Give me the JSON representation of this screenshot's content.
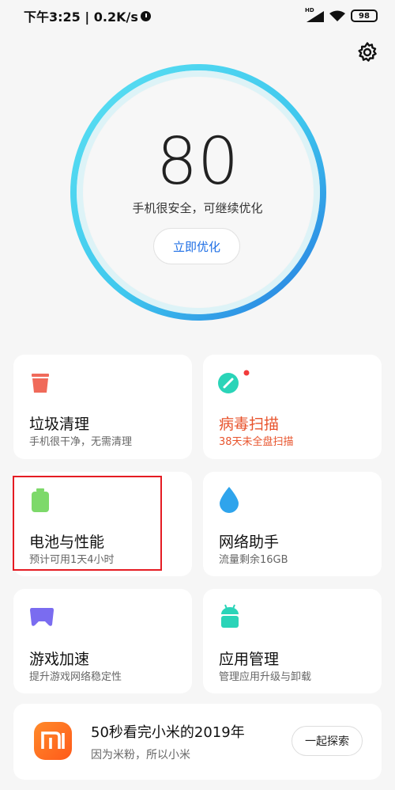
{
  "status_bar": {
    "time_text": "下午3:25 | 0.2K/s",
    "network_label": "HD",
    "battery_level": "98"
  },
  "security": {
    "score": "80",
    "caption": "手机很安全，可继续优化",
    "optimize_label": "立即优化"
  },
  "cards": {
    "cleaner": {
      "title": "垃圾清理",
      "subtitle": "手机很干净，无需清理"
    },
    "virus": {
      "title": "病毒扫描",
      "subtitle": "38天未全盘扫描"
    },
    "battery": {
      "title": "电池与性能",
      "subtitle": "预计可用1天4小时"
    },
    "network": {
      "title": "网络助手",
      "subtitle": "流量剩余16GB"
    },
    "game": {
      "title": "游戏加速",
      "subtitle": "提升游戏网络稳定性"
    },
    "apps": {
      "title": "应用管理",
      "subtitle": "管理应用升级与卸载"
    }
  },
  "promo": {
    "title": "50秒看完小米的2019年",
    "subtitle": "因为米粉，所以小米",
    "button_label": "一起探索"
  },
  "icons": {
    "cleaner": "trash-icon",
    "virus": "scan-icon",
    "battery": "battery-icon",
    "network": "droplet-icon",
    "game": "gamepad-icon",
    "apps": "android-icon",
    "settings": "gear-icon",
    "brand": "mi-logo"
  },
  "colors": {
    "accent_blue": "#1f6fe5",
    "warning_red": "#e8542d",
    "ring_cyan": "#4fd6ee",
    "ring_blue": "#2a86e6"
  }
}
